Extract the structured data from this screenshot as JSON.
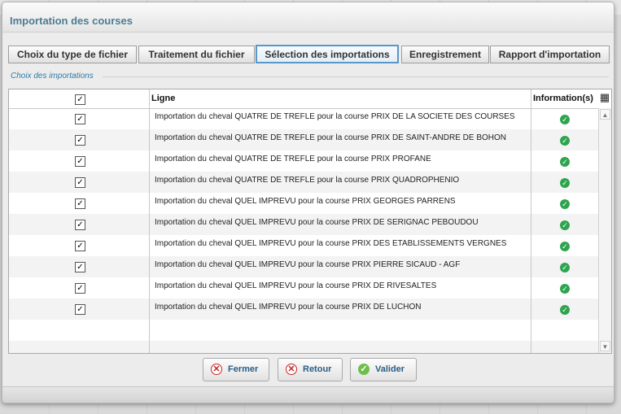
{
  "dialog": {
    "title": "Importation des courses"
  },
  "tabs": [
    {
      "label": "Choix du type de fichier",
      "active": false
    },
    {
      "label": "Traitement du fichier",
      "active": false
    },
    {
      "label": "Sélection des importations",
      "active": true
    },
    {
      "label": "Enregistrement",
      "active": false
    },
    {
      "label": "Rapport d'importation",
      "active": false
    }
  ],
  "section": {
    "label": "Choix des importations"
  },
  "grid": {
    "columns": {
      "select": "✓",
      "ligne": "Ligne",
      "information": "Information(s)"
    },
    "header_checked": true,
    "rows": [
      {
        "checked": true,
        "ligne": "Importation du cheval QUATRE DE TREFLE pour la course PRIX DE LA SOCIETE DES COURSES",
        "status_icon": "check-circle-icon"
      },
      {
        "checked": true,
        "ligne": "Importation du cheval QUATRE DE TREFLE pour la course PRIX DE SAINT-ANDRE DE BOHON",
        "status_icon": "check-circle-icon"
      },
      {
        "checked": true,
        "ligne": "Importation du cheval QUATRE DE TREFLE pour la course PRIX PROFANE",
        "status_icon": "check-circle-icon"
      },
      {
        "checked": true,
        "ligne": "Importation du cheval QUATRE DE TREFLE pour la course PRIX QUADROPHENIO",
        "status_icon": "check-circle-icon"
      },
      {
        "checked": true,
        "ligne": "Importation du cheval QUEL IMPREVU pour la course PRIX GEORGES PARRENS",
        "status_icon": "check-circle-icon"
      },
      {
        "checked": true,
        "ligne": "Importation du cheval QUEL IMPREVU pour la course PRIX DE SERIGNAC PEBOUDOU",
        "status_icon": "check-circle-icon"
      },
      {
        "checked": true,
        "ligne": "Importation du cheval QUEL IMPREVU pour la course PRIX DES ETABLISSEMENTS VERGNES",
        "status_icon": "check-circle-icon"
      },
      {
        "checked": true,
        "ligne": "Importation du cheval QUEL IMPREVU pour la course PRIX PIERRE SICAUD - AGF",
        "status_icon": "check-circle-icon"
      },
      {
        "checked": true,
        "ligne": "Importation du cheval QUEL IMPREVU pour la course PRIX DE RIVESALTES",
        "status_icon": "check-circle-icon"
      },
      {
        "checked": true,
        "ligne": "Importation du cheval QUEL IMPREVU pour la course PRIX DE LUCHON",
        "status_icon": "check-circle-icon"
      }
    ]
  },
  "buttons": {
    "fermer": "Fermer",
    "retour": "Retour",
    "valider": "Valider"
  },
  "colors": {
    "accent": "#4c7c93",
    "active_tab_border": "#5b97c6",
    "success": "#2ea44f",
    "danger": "#c62828"
  }
}
